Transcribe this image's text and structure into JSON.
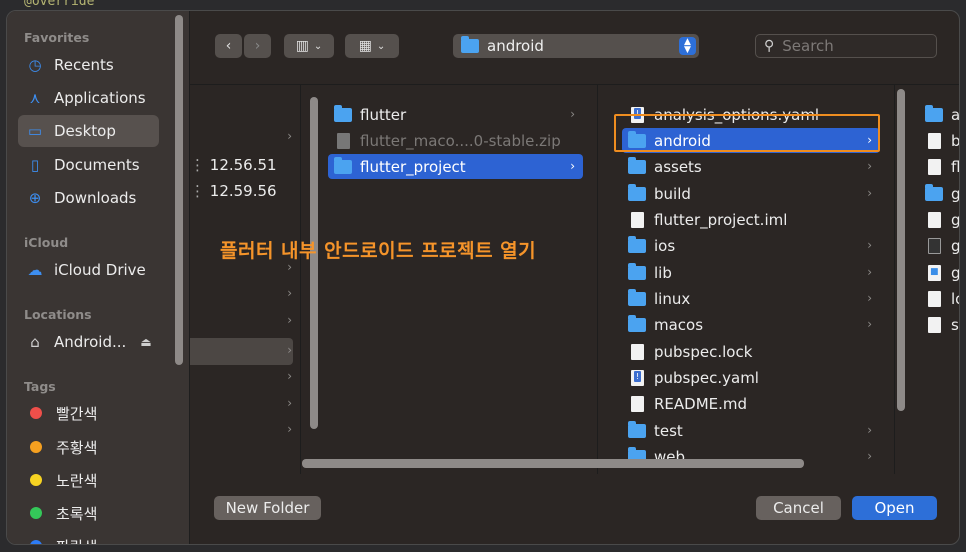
{
  "background": {
    "code_text": "@override"
  },
  "sidebar": {
    "favorites_header": "Favorites",
    "favorites": [
      {
        "label": "Recents",
        "icon": "clock-icon"
      },
      {
        "label": "Applications",
        "icon": "applications-icon"
      },
      {
        "label": "Desktop",
        "icon": "desktop-icon",
        "selected": true
      },
      {
        "label": "Documents",
        "icon": "document-icon"
      },
      {
        "label": "Downloads",
        "icon": "download-icon"
      }
    ],
    "icloud_header": "iCloud",
    "icloud_drive": "iCloud Drive",
    "locations_header": "Locations",
    "location_item": "Android...",
    "tags_header": "Tags",
    "tags": [
      {
        "label": "빨간색",
        "color": "#ee4f4a"
      },
      {
        "label": "주황색",
        "color": "#f5a020"
      },
      {
        "label": "노란색",
        "color": "#f6d322"
      },
      {
        "label": "초록색",
        "color": "#34c759"
      },
      {
        "label": "파란색",
        "color": "#2d7cf6"
      }
    ]
  },
  "toolbar": {
    "path_folder": "android",
    "search_placeholder": "Search"
  },
  "columns": {
    "col0": {
      "times": [
        "12.56.51",
        "12.59.56"
      ]
    },
    "col1": [
      {
        "label": "flutter",
        "type": "folder"
      },
      {
        "label": "flutter_maco....0-stable.zip",
        "type": "file",
        "dim": true
      },
      {
        "label": "flutter_project",
        "type": "folder",
        "selected": true
      }
    ],
    "col2": [
      {
        "label": "analysis_options.yaml",
        "type": "yaml"
      },
      {
        "label": "android",
        "type": "folder",
        "selected": true
      },
      {
        "label": "assets",
        "type": "folder"
      },
      {
        "label": "build",
        "type": "folder"
      },
      {
        "label": "flutter_project.iml",
        "type": "file"
      },
      {
        "label": "ios",
        "type": "folder"
      },
      {
        "label": "lib",
        "type": "folder"
      },
      {
        "label": "linux",
        "type": "folder"
      },
      {
        "label": "macos",
        "type": "folder"
      },
      {
        "label": "pubspec.lock",
        "type": "file"
      },
      {
        "label": "pubspec.yaml",
        "type": "yaml"
      },
      {
        "label": "README.md",
        "type": "file"
      },
      {
        "label": "test",
        "type": "folder"
      },
      {
        "label": "web",
        "type": "folder"
      }
    ],
    "col3": [
      {
        "label": "ap",
        "type": "folder"
      },
      {
        "label": "bu",
        "type": "file"
      },
      {
        "label": "flu",
        "type": "file"
      },
      {
        "label": "gr",
        "type": "folder"
      },
      {
        "label": "gr",
        "type": "file"
      },
      {
        "label": "gr",
        "type": "term"
      },
      {
        "label": "gr",
        "type": "win"
      },
      {
        "label": "lo",
        "type": "file"
      },
      {
        "label": "se",
        "type": "file"
      }
    ]
  },
  "annotation": "플러터 내부 안드로이드 프로젝트 열기",
  "buttons": {
    "new_folder": "New Folder",
    "cancel": "Cancel",
    "open": "Open"
  }
}
